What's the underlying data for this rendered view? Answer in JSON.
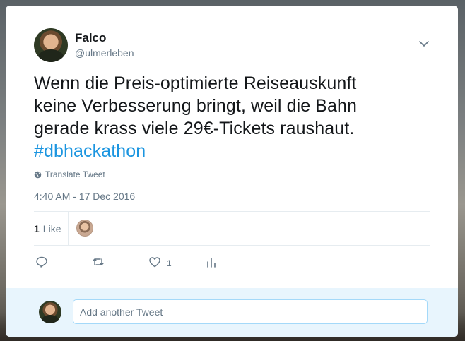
{
  "tweet": {
    "author": {
      "name": "Falco",
      "handle": "@ulmerleben"
    },
    "text_lines": [
      "Wenn die Preis-optimierte Reiseauskunft",
      "keine Verbesserung bringt, weil die Bahn",
      "gerade krass viele 29€-Tickets raushaut."
    ],
    "hashtag": "#dbhackathon",
    "translate_label": "Translate Tweet",
    "timestamp": "4:40 AM - 17 Dec 2016",
    "stats": {
      "likes_count": "1",
      "likes_label": "Like"
    },
    "actions": {
      "reply_icon": "reply-icon",
      "retweet_icon": "retweet-icon",
      "like_icon": "heart-icon",
      "like_count": "1",
      "analytics_icon": "analytics-icon"
    }
  },
  "reply": {
    "placeholder": "Add another Tweet"
  },
  "colors": {
    "link": "#1b95e0",
    "muted": "#657786",
    "text": "#14171a",
    "reply_bg": "#e8f5fd"
  }
}
